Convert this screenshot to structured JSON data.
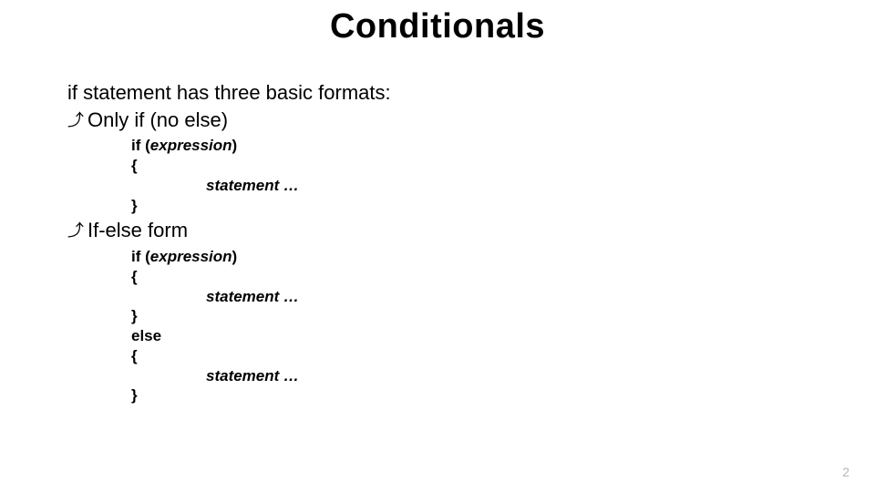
{
  "title": "Conditionals",
  "intro": "if statement has three basic formats:",
  "bullets": {
    "arrow": "⤴",
    "onlyIf": "Only if (no else)",
    "ifElse": "If-else form"
  },
  "code": {
    "if_kw": "if (",
    "expression": "expression",
    "close_paren": ")",
    "open_brace": "{",
    "close_brace": "}",
    "else_kw": "else",
    "statement": "statement …"
  },
  "pageNumber": "2"
}
